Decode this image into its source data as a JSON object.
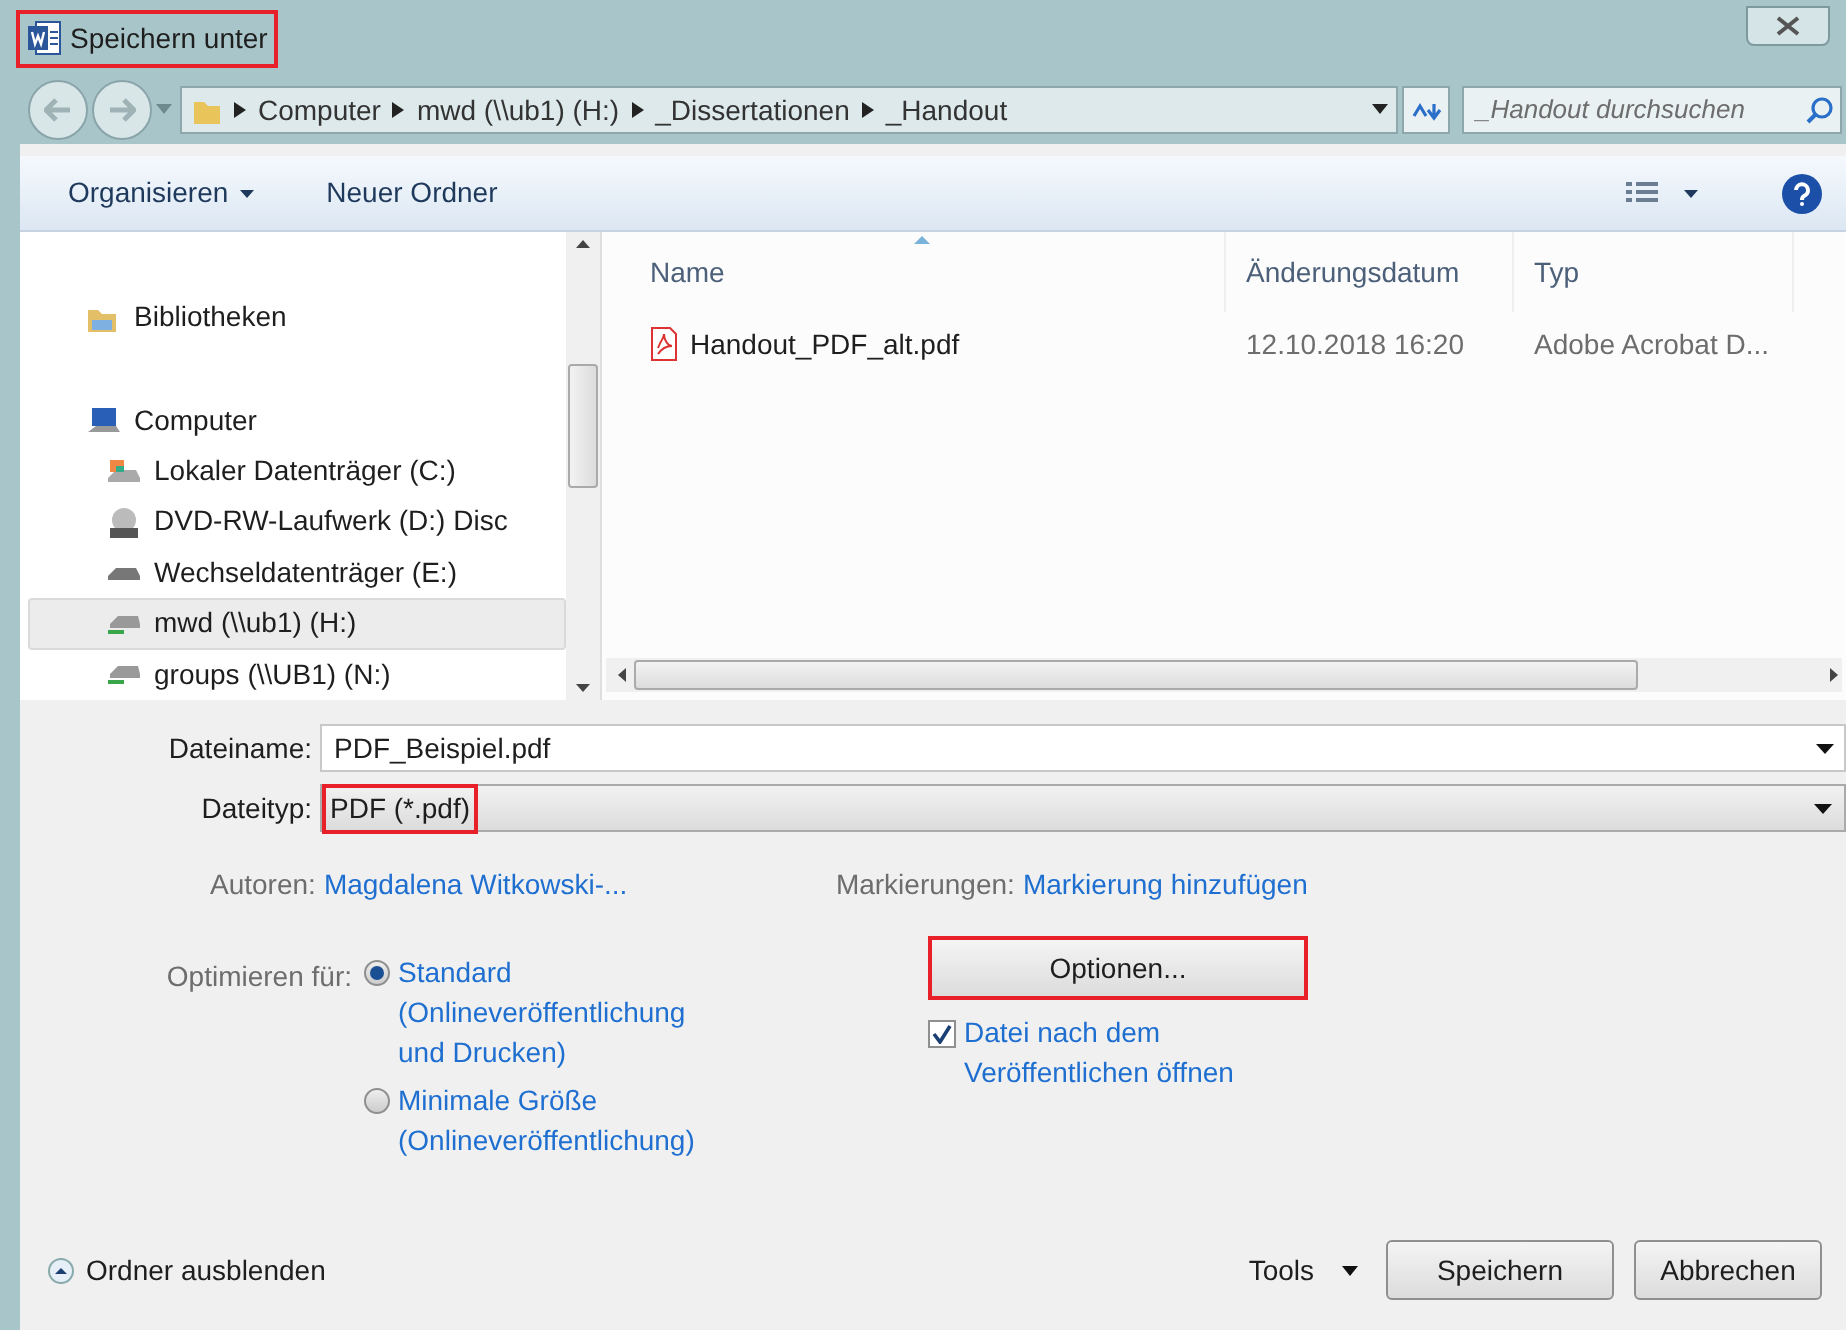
{
  "window": {
    "title": "Speichern unter",
    "title_highlighted": true
  },
  "address": {
    "path": [
      "Computer",
      "mwd (\\\\ub1) (H:)",
      "_Dissertationen",
      "_Handout"
    ],
    "search_placeholder": "_Handout durchsuchen"
  },
  "toolbar": {
    "items": [
      "Organisieren",
      "Neuer Ordner"
    ]
  },
  "sidebar": {
    "items": [
      {
        "label": "Bibliotheken",
        "kind": "library",
        "selected": false
      },
      {
        "label": "Computer",
        "kind": "computer",
        "selected": false,
        "children": [
          {
            "label": "Lokaler Datenträger (C:)",
            "kind": "local",
            "selected": false
          },
          {
            "label": "DVD-RW-Laufwerk (D:) Disc",
            "kind": "dvd",
            "selected": false
          },
          {
            "label": "Wechseldatenträger (E:)",
            "kind": "removable",
            "selected": false
          },
          {
            "label": "mwd (\\\\ub1) (H:)",
            "kind": "network",
            "selected": true
          },
          {
            "label": "groups (\\\\UB1) (N:)",
            "kind": "network",
            "selected": false
          }
        ]
      }
    ]
  },
  "table": {
    "columns": [
      {
        "label": "Name",
        "sorted": true
      },
      {
        "label": "Änderungsdatum",
        "sorted": false
      },
      {
        "label": "Typ",
        "sorted": false
      }
    ],
    "rows": [
      [
        "Handout_PDF_alt.pdf",
        "12.10.2018 16:20",
        "Adobe Acrobat D..."
      ]
    ]
  },
  "form": {
    "filename_label": "Dateiname:",
    "filename": "PDF_Beispiel.pdf",
    "filetype_label": "Dateityp:",
    "filetype": "PDF (*.pdf)",
    "filetype_highlighted": true,
    "authors_label": "Autoren:",
    "authors": "Magdalena Witkowski-...",
    "tags_label": "Markierungen:",
    "tags": "Markierung hinzufügen"
  },
  "optimize": {
    "label": "Optimieren für:",
    "options": [
      {
        "label": "Standard (Onlineveröffentlichung und Drucken)",
        "selected": true
      },
      {
        "label": "Minimale Größe (Onlineveröffentlichung)",
        "selected": false
      }
    ]
  },
  "options_button": {
    "label": "Optionen...",
    "highlighted": true
  },
  "open_after": {
    "label": "Datei nach dem Veröffentlichen öffnen",
    "checked": true
  },
  "footer": {
    "hide_folders": "Ordner ausblenden",
    "tools": "Tools",
    "buttons": [
      "Speichern",
      "Abbrechen"
    ]
  }
}
